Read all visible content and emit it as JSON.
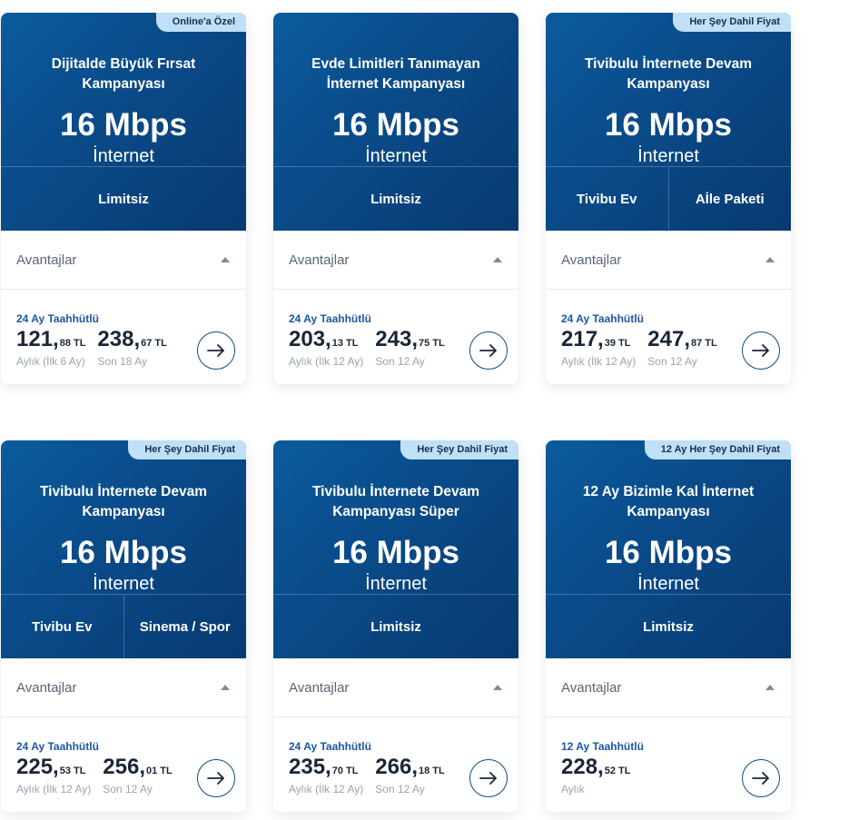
{
  "cards": [
    {
      "badge": "Online'a Özel",
      "title": "Dijitalde Büyük Fırsat Kampanyası",
      "speed": "16 Mbps",
      "service": "İnternet",
      "options": [
        "Limitsiz"
      ],
      "advantages_label": "Avantajlar",
      "term": "24 Ay Taahhütlü",
      "prices": [
        {
          "int": "121",
          "dec": "88",
          "currency": "TL",
          "note": "Aylık (İlk 6 Ay)"
        },
        {
          "int": "238",
          "dec": "67",
          "currency": "TL",
          "note": "Son 18 Ay"
        }
      ],
      "arrow_icon": "arrow-right-icon"
    },
    {
      "badge": "",
      "title": "Evde Limitleri Tanımayan İnternet Kampanyası",
      "speed": "16 Mbps",
      "service": "İnternet",
      "options": [
        "Limitsiz"
      ],
      "advantages_label": "Avantajlar",
      "term": "24 Ay Taahhütlü",
      "prices": [
        {
          "int": "203",
          "dec": "13",
          "currency": "TL",
          "note": "Aylık (İlk 12 Ay)"
        },
        {
          "int": "243",
          "dec": "75",
          "currency": "TL",
          "note": "Son 12 Ay"
        }
      ],
      "arrow_icon": "arrow-right-icon"
    },
    {
      "badge": "Her Şey Dahil Fiyat",
      "title": "Tivibulu İnternete Devam Kampanyası",
      "speed": "16 Mbps",
      "service": "İnternet",
      "options": [
        "Tivibu Ev",
        "Aİle Paketi"
      ],
      "advantages_label": "Avantajlar",
      "term": "24 Ay Taahhütlü",
      "prices": [
        {
          "int": "217",
          "dec": "39",
          "currency": "TL",
          "note": "Aylık (İlk 12 Ay)"
        },
        {
          "int": "247",
          "dec": "87",
          "currency": "TL",
          "note": "Son 12 Ay"
        }
      ],
      "arrow_icon": "arrow-right-icon"
    },
    {
      "badge": "Her Şey Dahil Fiyat",
      "title": "Tivibulu İnternete Devam Kampanyası",
      "speed": "16 Mbps",
      "service": "İnternet",
      "options": [
        "Tivibu Ev",
        "Sinema / Spor"
      ],
      "advantages_label": "Avantajlar",
      "term": "24 Ay Taahhütlü",
      "prices": [
        {
          "int": "225",
          "dec": "53",
          "currency": "TL",
          "note": "Aylık (İlk 12 Ay)"
        },
        {
          "int": "256",
          "dec": "01",
          "currency": "TL",
          "note": "Son 12 Ay"
        }
      ],
      "arrow_icon": "arrow-right-icon"
    },
    {
      "badge": "Her Şey Dahil Fiyat",
      "title": "Tivibulu İnternete Devam Kampanyası Süper",
      "speed": "16 Mbps",
      "service": "İnternet",
      "options": [
        "Limitsiz"
      ],
      "advantages_label": "Avantajlar",
      "term": "24 Ay Taahhütlü",
      "prices": [
        {
          "int": "235",
          "dec": "70",
          "currency": "TL",
          "note": "Aylık (İlk 12 Ay)"
        },
        {
          "int": "266",
          "dec": "18",
          "currency": "TL",
          "note": "Son 12 Ay"
        }
      ],
      "arrow_icon": "arrow-right-icon"
    },
    {
      "badge": "12 Ay Her Şey Dahil Fiyat",
      "title": "12 Ay Bizimle Kal İnternet Kampanyası",
      "speed": "16 Mbps",
      "service": "İnternet",
      "options": [
        "Limitsiz"
      ],
      "advantages_label": "Avantajlar",
      "term": "12 Ay Taahhütlü",
      "prices": [
        {
          "int": "228",
          "dec": "52",
          "currency": "TL",
          "note": "Aylık"
        }
      ],
      "arrow_icon": "arrow-right-icon"
    }
  ]
}
